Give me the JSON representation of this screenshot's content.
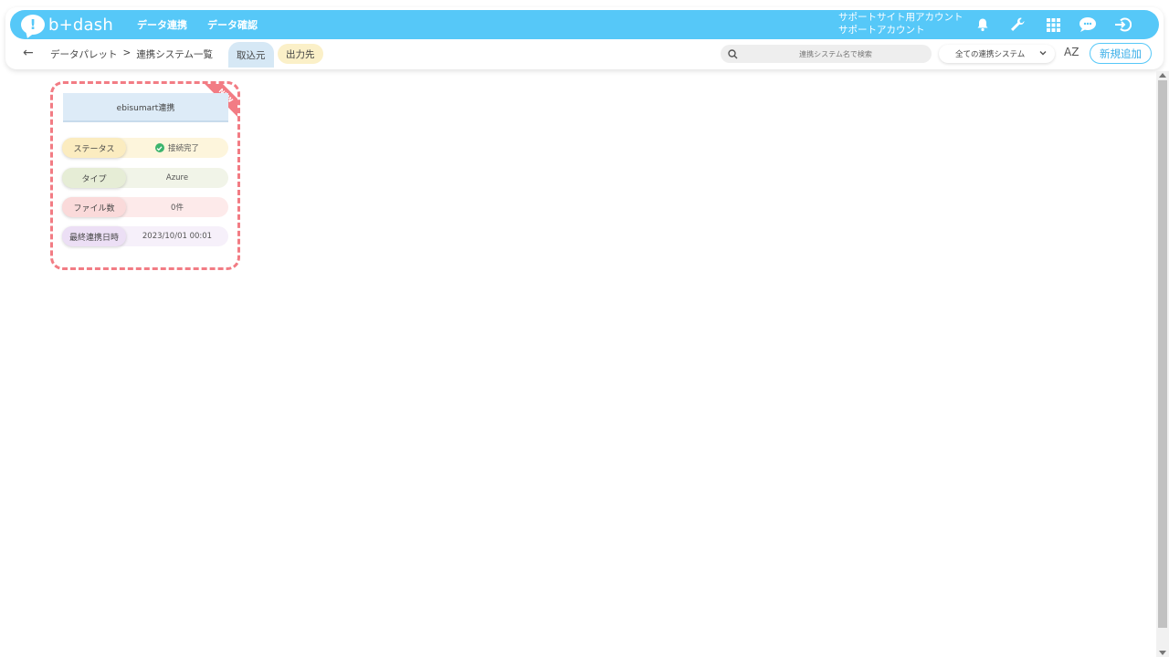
{
  "header": {
    "logo_text": "b+dash",
    "logo_mark": "!",
    "nav": [
      {
        "label": "データ連携"
      },
      {
        "label": "データ確認"
      }
    ],
    "account_line1": "サポートサイト用アカウント",
    "account_line2": "サポートアカウント",
    "icons": [
      "bell-icon",
      "wrench-icon",
      "grid-icon",
      "chat-icon",
      "logout-icon"
    ]
  },
  "subbar": {
    "breadcrumb": [
      "データパレット",
      ">",
      "連携システム一覧"
    ],
    "tabs": [
      {
        "label": "取込元",
        "active": true
      },
      {
        "label": "出力先",
        "active": false
      }
    ],
    "search_placeholder": "連携システム名で検索",
    "filter_value": "全ての連携システム",
    "sort_label": "AZ",
    "new_button": "新規追加"
  },
  "cards": [
    {
      "title": "ebisumart連携",
      "badge": "NEW",
      "rows": [
        {
          "label": "ステータス",
          "value": "接続完了"
        },
        {
          "label": "タイプ",
          "value": "Azure"
        },
        {
          "label": "ファイル数",
          "value": "0件"
        },
        {
          "label": "最終連携日時",
          "value": "2023/10/01 00:01"
        }
      ]
    }
  ],
  "colors": {
    "brand": "#56c8f8",
    "accent_border": "#f27c84",
    "status_ok": "#3cb46e"
  }
}
